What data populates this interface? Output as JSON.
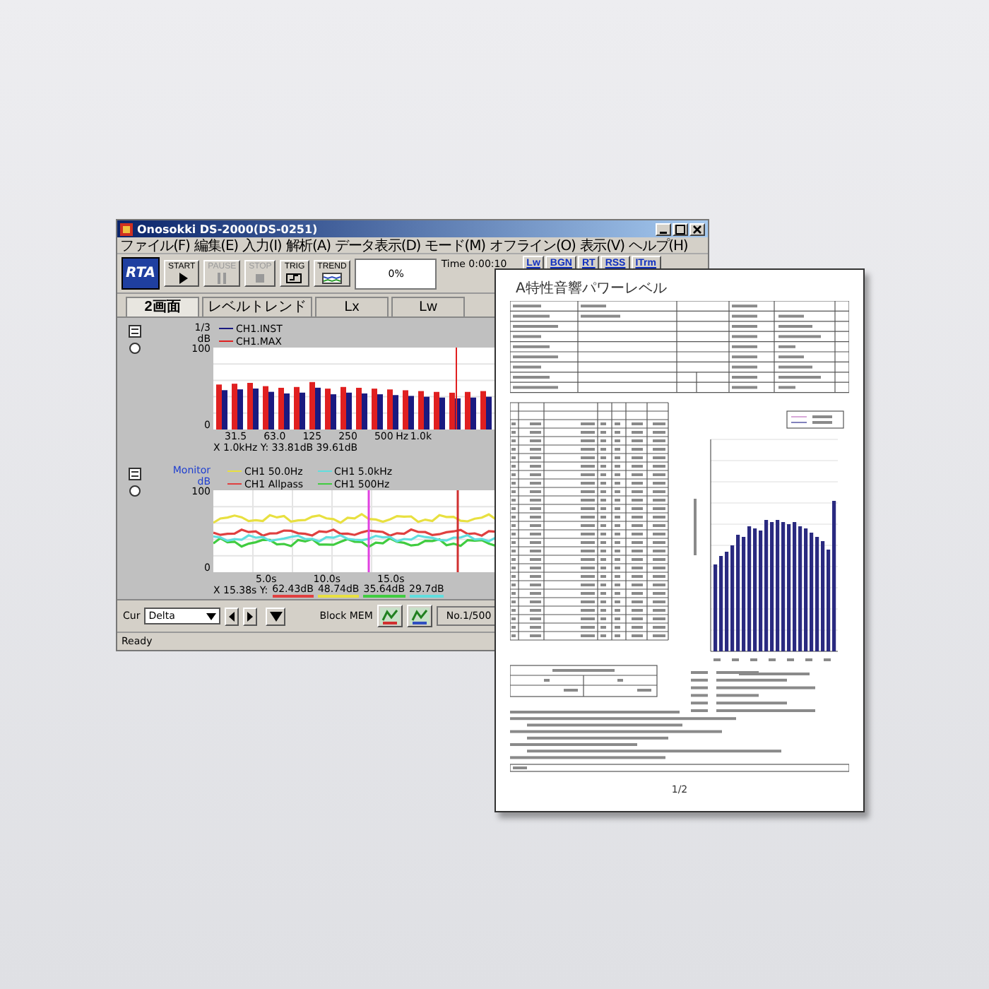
{
  "window": {
    "title": "Onosokki DS-2000(DS-0251)"
  },
  "menu": [
    "ファイル(F)",
    "編集(E)",
    "入力(I)",
    "解析(A)",
    "データ表示(D)",
    "モード(M)",
    "オフライン(O)",
    "表示(V)",
    "ヘルプ(H)"
  ],
  "toolbar": {
    "logo": "RTA",
    "buttons": [
      {
        "label": "START",
        "kind": "play",
        "disabled": false
      },
      {
        "label": "PAUSE",
        "kind": "pause",
        "disabled": true
      },
      {
        "label": "STOP",
        "kind": "stop",
        "disabled": true
      },
      {
        "label": "TRIG",
        "kind": "trigger",
        "disabled": false
      },
      {
        "label": "TREND",
        "kind": "trend",
        "disabled": false
      }
    ],
    "progress": {
      "level": 0,
      "reading": "0%"
    },
    "time": "Time 0:00:10",
    "modes": [
      "Lw",
      "BGN",
      "RT",
      "RSS",
      "ITrm"
    ]
  },
  "tabs": [
    {
      "label": "2画面",
      "selected": true
    },
    {
      "label": "レベルトレンド",
      "selected": false
    },
    {
      "label": "Lx",
      "selected": false
    },
    {
      "label": "Lw",
      "selected": false
    }
  ],
  "spectrum": {
    "option_checked": false,
    "unit": [
      "1/3",
      "dB"
    ],
    "legend": [
      {
        "name": "CH1.INST",
        "color": "#1a1a80"
      },
      {
        "name": "CH1.MAX",
        "color": "#e02020"
      }
    ],
    "yticks": [
      "100",
      "0"
    ],
    "xticks": [
      "31.5",
      "63.0",
      "125",
      "250",
      "500",
      "1.0k"
    ],
    "xunit": "Hz",
    "readout": "X 1.0kHz Y: 33.81dB 39.61dB"
  },
  "trend": {
    "option_checked": false,
    "unit": [
      "Monitor",
      "dB"
    ],
    "legend": [
      {
        "name": "CH1 50.0Hz",
        "color": "#e8e040"
      },
      {
        "name": "CH1 5.0kHz",
        "color": "#60dede"
      },
      {
        "name": "CH1 Allpass",
        "color": "#e04040"
      },
      {
        "name": "CH1 500Hz",
        "color": "#40cc40"
      }
    ],
    "yticks": [
      "100",
      "0"
    ],
    "xticks": [
      "5.0s",
      "10.0s",
      "15.0s"
    ],
    "readout_label": "X 15.38s Y:",
    "readings": [
      {
        "value": "62.43dB",
        "color": "#e04040"
      },
      {
        "value": "48.74dB",
        "color": "#e8e040"
      },
      {
        "value": "35.64dB",
        "color": "#40cc40"
      },
      {
        "value": "29.7dB",
        "color": "#60dede"
      }
    ]
  },
  "bottom_bar": {
    "cursor_label": "Cur",
    "cursor_mode": "Delta",
    "block": "Block MEM",
    "record": "No.1/500"
  },
  "status_bar": "Ready",
  "document": {
    "title": "A特性音響パワーレベル",
    "page": "1/2"
  }
}
